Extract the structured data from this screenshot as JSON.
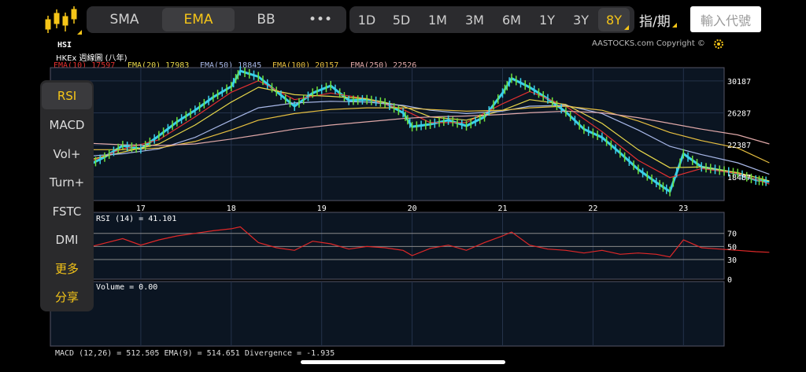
{
  "toolbar": {
    "indicator_tabs": [
      {
        "label": "SMA",
        "active": false
      },
      {
        "label": "EMA",
        "active": true
      },
      {
        "label": "BB",
        "active": false
      },
      {
        "label": "•••",
        "active": false
      }
    ],
    "timeframes": [
      {
        "label": "1D",
        "active": false
      },
      {
        "label": "5D",
        "active": false
      },
      {
        "label": "1M",
        "active": false
      },
      {
        "label": "3M",
        "active": false
      },
      {
        "label": "6M",
        "active": false
      },
      {
        "label": "1Y",
        "active": false
      },
      {
        "label": "3Y",
        "active": false
      },
      {
        "label": "8Y",
        "active": true
      }
    ],
    "index_period_label": "指/期",
    "code_input_placeholder": "輸入代號"
  },
  "chart_header": {
    "symbol": "HSI",
    "subtitle": "HKEx 週線圖 (八年)",
    "copyright": "AASTOCKS.com Copyright ©",
    "ema_legend": [
      {
        "label": "EMA(10) 17597",
        "color": "#e23030"
      },
      {
        "label": "EMA(20) 17983",
        "color": "#e8d84a"
      },
      {
        "label": "EMA(50) 18845",
        "color": "#a8b8e8"
      },
      {
        "label": "EMA(100) 20157",
        "color": "#e8c040"
      },
      {
        "label": "EMA(250) 22526",
        "color": "#e0a8a8"
      }
    ]
  },
  "side_menu": [
    {
      "label": "RSI",
      "active": true,
      "highlight": false
    },
    {
      "label": "MACD",
      "active": false,
      "highlight": false
    },
    {
      "label": "Vol+",
      "active": false,
      "highlight": false
    },
    {
      "label": "Turn+",
      "active": false,
      "highlight": false
    },
    {
      "label": "FSTC",
      "active": false,
      "highlight": false
    },
    {
      "label": "DMI",
      "active": false,
      "highlight": false
    },
    {
      "label": "更多",
      "active": false,
      "highlight": true
    },
    {
      "label": "分享",
      "active": false,
      "highlight": true
    }
  ],
  "rsi_panel": {
    "label": "RSI (14) = 41.101",
    "levels": [
      "70",
      "50",
      "30",
      "0"
    ]
  },
  "volume_panel": {
    "label": "Volume = 0.00"
  },
  "bottom_partial_text": "MACD (12,26) = 512.505   EMA(9) = 514.651   Divergence = -1.935",
  "chart_data": {
    "type": "line",
    "title": "HSI",
    "x_ticks": [
      "17",
      "18",
      "19",
      "20",
      "21",
      "22",
      "23"
    ],
    "y_ticks": [
      30187,
      26287,
      22387,
      18487
    ],
    "ylim": [
      15600,
      31800
    ],
    "series": [
      {
        "name": "HSI",
        "color": "#3ad0e8",
        "x": [
          16.4,
          16.6,
          16.8,
          17.0,
          17.2,
          17.4,
          17.6,
          17.8,
          18.0,
          18.1,
          18.3,
          18.5,
          18.7,
          18.9,
          19.1,
          19.3,
          19.5,
          19.7,
          19.9,
          20.0,
          20.2,
          20.4,
          20.6,
          20.8,
          21.0,
          21.1,
          21.3,
          21.5,
          21.7,
          21.9,
          22.1,
          22.3,
          22.5,
          22.7,
          22.85,
          23.0,
          23.2,
          23.4,
          23.6,
          23.8,
          23.95
        ],
        "values": [
          19800,
          20900,
          22300,
          21900,
          23500,
          25200,
          26600,
          28200,
          29500,
          31400,
          30700,
          28900,
          27100,
          28700,
          29600,
          27800,
          27900,
          27500,
          26300,
          24600,
          24900,
          25400,
          24700,
          25800,
          28700,
          30500,
          29400,
          28000,
          26400,
          24300,
          23300,
          21400,
          19400,
          17800,
          16700,
          21300,
          19700,
          19300,
          18900,
          18100,
          17900
        ]
      },
      {
        "name": "EMA(10)",
        "color": "#e23030",
        "x": [
          16.4,
          16.8,
          17.2,
          17.6,
          18.0,
          18.3,
          18.7,
          19.1,
          19.5,
          19.9,
          20.2,
          20.6,
          21.0,
          21.3,
          21.7,
          22.1,
          22.5,
          22.85,
          23.2,
          23.6,
          23.95
        ],
        "values": [
          20200,
          21900,
          23000,
          25800,
          28800,
          30200,
          27900,
          28700,
          28000,
          26700,
          25100,
          25100,
          27400,
          28900,
          27100,
          24000,
          20500,
          18400,
          19500,
          18900,
          17600
        ]
      },
      {
        "name": "EMA(20)",
        "color": "#e8d84a",
        "x": [
          16.4,
          16.8,
          17.2,
          17.6,
          18.0,
          18.3,
          18.7,
          19.1,
          19.5,
          19.9,
          20.2,
          20.6,
          21.0,
          21.3,
          21.7,
          22.1,
          22.5,
          22.85,
          23.2,
          23.6,
          23.95
        ],
        "values": [
          20500,
          21500,
          22500,
          24800,
          27600,
          29400,
          28500,
          28300,
          28000,
          27100,
          25800,
          25400,
          26600,
          27900,
          27300,
          25000,
          21800,
          19600,
          19700,
          19000,
          18000
        ]
      },
      {
        "name": "EMA(50)",
        "color": "#a8b8e8",
        "x": [
          16.4,
          16.8,
          17.2,
          17.6,
          18.0,
          18.3,
          18.7,
          19.1,
          19.5,
          19.9,
          20.2,
          20.6,
          21.0,
          21.3,
          21.7,
          22.1,
          22.5,
          22.85,
          23.2,
          23.6,
          23.95
        ],
        "values": [
          21000,
          21300,
          21900,
          23300,
          25400,
          26900,
          27500,
          27700,
          27600,
          27200,
          26600,
          26200,
          26500,
          27100,
          27200,
          26200,
          24200,
          22200,
          21200,
          20200,
          18800
        ]
      },
      {
        "name": "EMA(100)",
        "color": "#e8c040",
        "x": [
          16.4,
          16.8,
          17.2,
          17.6,
          18.0,
          18.3,
          18.7,
          19.1,
          19.5,
          19.9,
          20.2,
          20.6,
          21.0,
          21.3,
          21.7,
          22.1,
          22.5,
          22.85,
          23.2,
          23.6,
          23.95
        ],
        "values": [
          21800,
          21800,
          22000,
          22800,
          24200,
          25400,
          26200,
          26700,
          26900,
          26900,
          26700,
          26500,
          26600,
          26900,
          27100,
          26600,
          25300,
          23900,
          22900,
          22000,
          20200
        ]
      },
      {
        "name": "EMA(250)",
        "color": "#e0a8a8",
        "x": [
          16.4,
          16.8,
          17.2,
          17.6,
          18.0,
          18.3,
          18.7,
          19.1,
          19.5,
          19.9,
          20.2,
          20.6,
          21.0,
          21.3,
          21.7,
          22.1,
          22.5,
          22.85,
          23.2,
          23.6,
          23.95
        ],
        "values": [
          22600,
          22400,
          22300,
          22500,
          23100,
          23600,
          24300,
          24800,
          25200,
          25600,
          25800,
          25900,
          26100,
          26300,
          26500,
          26300,
          25700,
          25000,
          24300,
          23600,
          22500
        ]
      }
    ],
    "rsi": {
      "x": [
        16.4,
        16.6,
        16.8,
        17.0,
        17.2,
        17.4,
        17.6,
        17.8,
        18.0,
        18.1,
        18.3,
        18.5,
        18.7,
        18.9,
        19.1,
        19.3,
        19.5,
        19.7,
        19.9,
        20.0,
        20.2,
        20.4,
        20.6,
        20.8,
        21.0,
        21.1,
        21.3,
        21.5,
        21.7,
        21.9,
        22.1,
        22.3,
        22.5,
        22.7,
        22.85,
        23.0,
        23.2,
        23.4,
        23.6,
        23.8,
        23.95
      ],
      "values": [
        48,
        55,
        62,
        52,
        60,
        66,
        70,
        74,
        77,
        80,
        56,
        48,
        44,
        58,
        54,
        46,
        50,
        48,
        44,
        36,
        47,
        52,
        44,
        56,
        66,
        72,
        52,
        46,
        44,
        40,
        44,
        38,
        40,
        38,
        34,
        60,
        48,
        46,
        44,
        42,
        41
      ],
      "ylim": [
        0,
        100
      ]
    }
  }
}
